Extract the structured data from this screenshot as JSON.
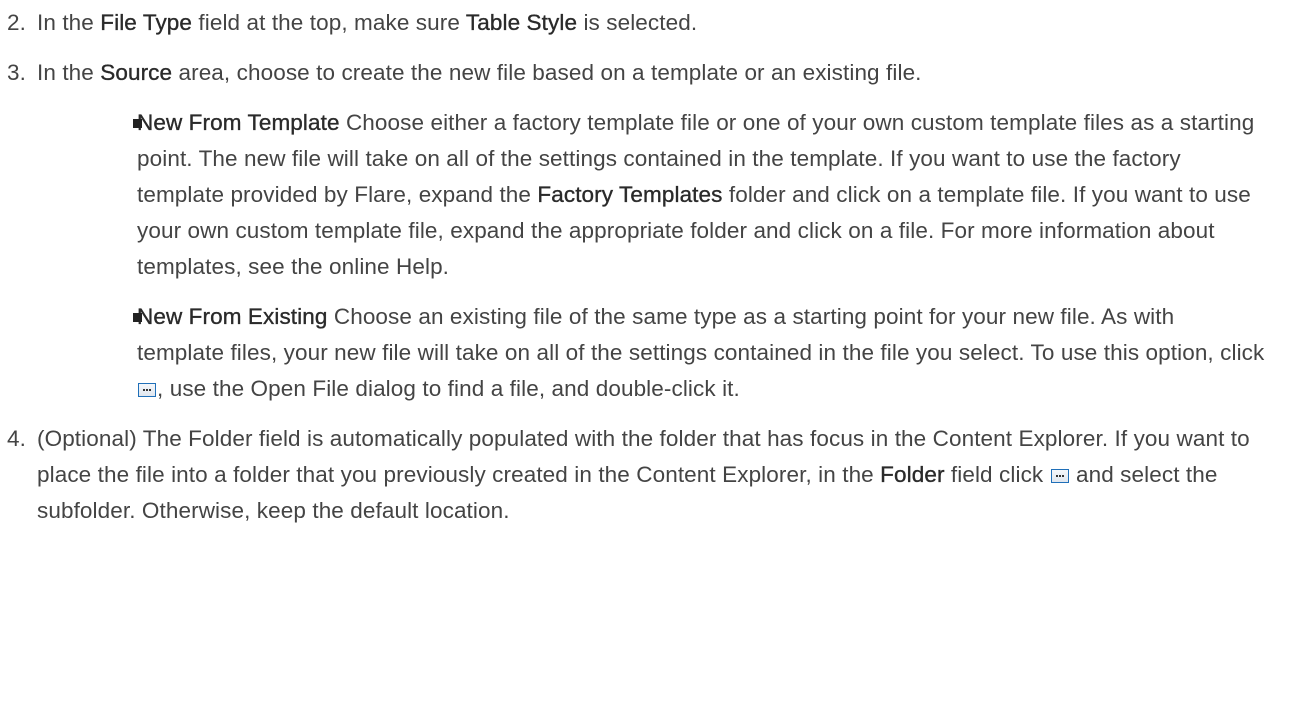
{
  "steps": [
    {
      "num": "2.",
      "p1": "In the ",
      "b1": "File Type",
      "p2": " field at the top, make sure ",
      "b2": "Table Style",
      "p3": " is selected."
    },
    {
      "num": "3.",
      "p1": "In the ",
      "b1": "Source",
      "p2": " area, choose to create the new file based on a template or an existing file.",
      "bullets": [
        {
          "title": "New From Template",
          "p1": " Choose either a factory template file or one of your own custom template files as a starting point. The new file will take on all of the settings contained in the template. If you want to use the factory template provided by Flare, expand the ",
          "b1": "Factory Templates",
          "p2": " folder and click on a template file. If you want to use your own custom template file, expand the appropriate folder and click on a file. For more information about templates, see the online Help."
        },
        {
          "title": "New From Existing",
          "p1": " Choose an existing file of the same type as a starting point for your new file. As with template files, your new file will take on all of the settings contained in the file you select. To use this option, click ",
          "p2": ", use the Open File dialog to find a file, and double-click it."
        }
      ]
    },
    {
      "num": "4.",
      "p1": "(Optional) The Folder field is automatically populated with the folder that has focus in the Content Explorer. If you want to place the file into a folder that you previously created in the Content Explorer, in the ",
      "b1": "Folder",
      "p2": " field click ",
      "p3": " and select the subfolder. Otherwise, keep the default location."
    }
  ],
  "icons": {
    "browse": "ellipsis-browse-icon"
  }
}
